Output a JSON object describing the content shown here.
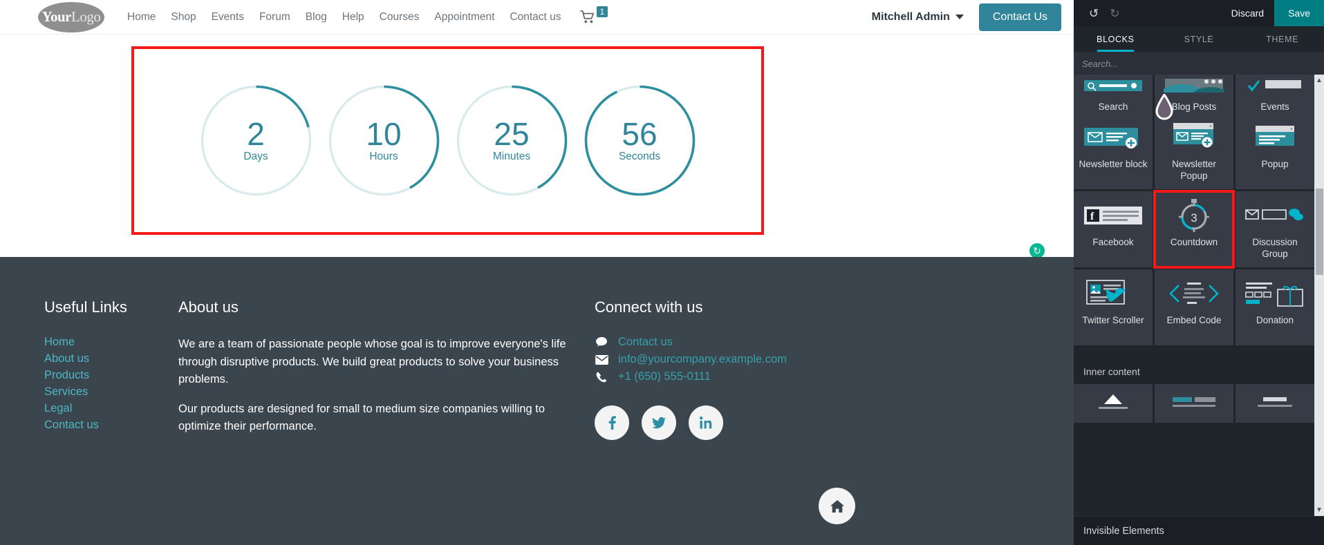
{
  "website": {
    "logo": {
      "bold": "Your",
      "light": "Logo"
    },
    "nav_links": [
      "Home",
      "Shop",
      "Events",
      "Forum",
      "Blog",
      "Help",
      "Courses",
      "Appointment",
      "Contact us"
    ],
    "cart": {
      "icon": "cart-icon",
      "count": "1"
    },
    "user": "Mitchell Admin",
    "cta_button": "Contact Us"
  },
  "countdown": {
    "items": [
      {
        "value": "2",
        "label": "Days",
        "progress": 0.21
      },
      {
        "value": "10",
        "label": "Hours",
        "progress": 0.42
      },
      {
        "value": "25",
        "label": "Minutes",
        "progress": 0.42
      },
      {
        "value": "56",
        "label": "Seconds",
        "progress": 0.93
      }
    ],
    "ring_color": "#2d8f9e",
    "track_color": "#d7eaec",
    "selection_color": "#f51919"
  },
  "refresh_badge": {
    "icon": "refresh-icon",
    "glyph": "↻",
    "color": "#00b894"
  },
  "footer": {
    "useful_links": {
      "title": "Useful Links",
      "items": [
        "Home",
        "About us",
        "Products",
        "Services",
        "Legal",
        "Contact us"
      ]
    },
    "about": {
      "title": "About us",
      "paragraph1": "We are a team of passionate people whose goal is to improve everyone's life through disruptive products. We build great products to solve your business problems.",
      "paragraph2": "Our products are designed for small to medium size companies willing to optimize their performance."
    },
    "connect": {
      "title": "Connect with us",
      "items": [
        {
          "icon": "comment-icon",
          "glyph": "💬",
          "text": "Contact us"
        },
        {
          "icon": "envelope-icon",
          "glyph": "✉",
          "text": "info@yourcompany.example.com"
        },
        {
          "icon": "phone-icon",
          "glyph": "☎",
          "text": "+1 (650) 555-0111"
        }
      ],
      "social": [
        {
          "icon": "facebook-icon",
          "glyph": "f"
        },
        {
          "icon": "twitter-icon",
          "glyph": "🐦"
        },
        {
          "icon": "linkedin-icon",
          "glyph": "in"
        }
      ]
    },
    "home_button": {
      "icon": "home-icon",
      "glyph": "⌂"
    }
  },
  "editor": {
    "history": [
      {
        "name": "undo-icon",
        "glyph": "↺",
        "enabled": true
      },
      {
        "name": "redo-icon",
        "glyph": "↻",
        "enabled": false
      }
    ],
    "discard_label": "Discard",
    "save_label": "Save",
    "tabs": [
      {
        "label": "BLOCKS",
        "active": true
      },
      {
        "label": "STYLE",
        "active": false
      },
      {
        "label": "THEME",
        "active": false
      }
    ],
    "search_placeholder": "Search...",
    "blocks_row_cut": [
      {
        "label": "Search"
      },
      {
        "label": "Blog Posts"
      },
      {
        "label": "Events"
      }
    ],
    "blocks": [
      {
        "label": "Newsletter block",
        "icon": "newsletter-block-thumb",
        "selected": false
      },
      {
        "label": "Newsletter Popup",
        "icon": "newsletter-popup-thumb",
        "selected": false
      },
      {
        "label": "Popup",
        "icon": "popup-thumb",
        "selected": false
      },
      {
        "label": "Facebook",
        "icon": "facebook-thumb",
        "selected": false
      },
      {
        "label": "Countdown",
        "icon": "countdown-thumb",
        "selected": true
      },
      {
        "label": "Discussion Group",
        "icon": "discussion-group-thumb",
        "selected": false
      },
      {
        "label": "Twitter Scroller",
        "icon": "twitter-scroller-thumb",
        "selected": false
      },
      {
        "label": "Embed Code",
        "icon": "embed-code-thumb",
        "selected": false
      },
      {
        "label": "Donation",
        "icon": "donation-thumb",
        "selected": false
      }
    ],
    "inner_content_label": "Inner content",
    "invisible_elements_label": "Invisible Elements",
    "accent_color": "#00b4cc",
    "save_color": "#017e84"
  }
}
